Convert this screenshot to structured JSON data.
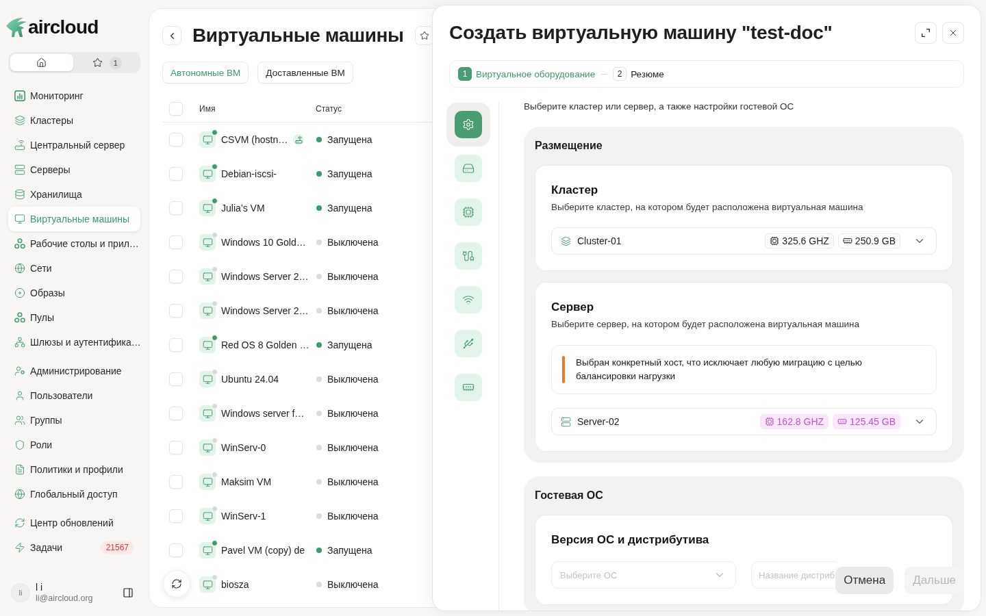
{
  "sidebar": {
    "logo": {
      "text": "aircloud"
    },
    "switcher": [
      {
        "kind": "home",
        "selected": true
      },
      {
        "kind": "favorites",
        "selected": false,
        "count": "1"
      }
    ],
    "nav_groups": [
      {
        "items": [
          {
            "label": "Мониторинг",
            "selected": false
          },
          {
            "label": "Кластеры",
            "selected": false
          },
          {
            "label": "Центральный сервер",
            "selected": false
          },
          {
            "label": "Серверы",
            "selected": false
          },
          {
            "label": "Хранилища",
            "selected": false
          },
          {
            "label": "Виртуальные машины",
            "selected": true
          },
          {
            "label": "Рабочие столы и прил…",
            "selected": false
          },
          {
            "label": "Сети",
            "selected": false
          },
          {
            "label": "Образы",
            "selected": false
          },
          {
            "label": "Пулы",
            "selected": false
          },
          {
            "label": "Шлюзы и аутентифика…",
            "selected": false
          }
        ]
      },
      {
        "items": [
          {
            "label": "Администрирование",
            "selected": false
          },
          {
            "label": "Пользователи",
            "selected": false
          },
          {
            "label": "Группы",
            "selected": false
          },
          {
            "label": "Роли",
            "selected": false
          },
          {
            "label": "Политики и профили",
            "selected": false
          },
          {
            "label": "Глобальный доступ",
            "selected": false
          }
        ]
      },
      {
        "items": [
          {
            "label": "Центр обновлений",
            "selected": false
          },
          {
            "label": "Задачи",
            "selected": false,
            "badge": "21567"
          }
        ]
      }
    ],
    "user": {
      "initials": "li",
      "name": "l i",
      "email": "li@aircloud.org"
    }
  },
  "page": {
    "title": "Виртуальные машины",
    "tabs": [
      {
        "label": "Автономные ВМ",
        "selected": true
      },
      {
        "label": "Доставленные ВМ",
        "selected": false
      }
    ],
    "table": {
      "select_all": {
        "checked": false
      },
      "columns": [
        "Имя",
        "Статус"
      ],
      "rows": [
        {
          "checked": false,
          "name": "CSVM (hostn…",
          "central_server": true,
          "running": true,
          "status": "Запущена"
        },
        {
          "checked": false,
          "name": "Debian-iscsi-",
          "central_server": false,
          "running": true,
          "status": "Запущена"
        },
        {
          "checked": false,
          "name": "Julia’s VM",
          "central_server": false,
          "running": true,
          "status": "Запущена"
        },
        {
          "checked": false,
          "name": "Windows 10 Gold…",
          "central_server": false,
          "running": false,
          "status": "Выключена"
        },
        {
          "checked": false,
          "name": "Windows Server 2…",
          "central_server": false,
          "running": false,
          "status": "Выключена"
        },
        {
          "checked": false,
          "name": "Windows Server 2…",
          "central_server": false,
          "running": false,
          "status": "Выключена"
        },
        {
          "checked": false,
          "name": "Red OS 8 Golden …",
          "central_server": false,
          "running": true,
          "status": "Запущена"
        },
        {
          "checked": false,
          "name": "Ubuntu 24.04",
          "central_server": false,
          "running": false,
          "status": "Выключена"
        },
        {
          "checked": false,
          "name": "Windows server f…",
          "central_server": false,
          "running": false,
          "status": "Выключена"
        },
        {
          "checked": false,
          "name": "WinServ-0",
          "central_server": false,
          "running": false,
          "status": "Выключена"
        },
        {
          "checked": false,
          "name": "Maksim VM",
          "central_server": false,
          "running": false,
          "status": "Выключена"
        },
        {
          "checked": false,
          "name": "WinServ-1",
          "central_server": false,
          "running": false,
          "status": "Выключена"
        },
        {
          "checked": false,
          "name": "Pavel VM (copy) de",
          "central_server": false,
          "running": true,
          "status": "Запущена"
        },
        {
          "name": "biosza",
          "central_server": false,
          "running": false,
          "status": "Выключена"
        }
      ]
    }
  },
  "modal": {
    "title": "Создать виртуальную машину \"test-doc\"",
    "steps": [
      {
        "number": "1",
        "label": "Виртуальное оборудование",
        "selected": true
      },
      {
        "number": "2",
        "label": "Резюме",
        "selected": false
      }
    ],
    "rail": [
      {
        "selected": true
      },
      {
        "selected": false
      },
      {
        "selected": false
      },
      {
        "selected": false
      },
      {
        "selected": false
      },
      {
        "selected": false
      },
      {
        "selected": false
      }
    ],
    "intro": "Выберите кластер или сервер, а также настройки гостевой ОС",
    "sections": [
      {
        "title": "Размещение",
        "cards": [
          {
            "kind": "cluster",
            "title": "Кластер",
            "description": "Выберите кластер, на котором будет расположена виртуальная машина",
            "select": {
              "value": "Cluster-01",
              "cpu": "325.6 GHZ",
              "ram": "250.9 GB",
              "highlighted": false
            }
          },
          {
            "kind": "server",
            "title": "Сервер",
            "description": "Выберите сервер, на котором будет расположена виртуальная машина",
            "alert": "Выбран конкретный хост, что исключает любую миграцию с целью балансировки нагрузки",
            "select": {
              "value": "Server-02",
              "cpu": "162.8 GHZ",
              "ram": "125.45 GB",
              "highlighted": true
            }
          }
        ]
      },
      {
        "title": "Гостевая ОС",
        "cards": [
          {
            "kind": "os",
            "title": "Версия ОС и дистрибутива",
            "os_select": {
              "placeholder": "Выберите ОС"
            },
            "distro_field": {
              "placeholder": "Название дистриб"
            }
          }
        ]
      }
    ],
    "buttons": [
      {
        "label": "Отмена",
        "kind": "secondary",
        "disabled": false
      },
      {
        "label": "Дальше",
        "kind": "primary",
        "disabled": true
      }
    ]
  }
}
